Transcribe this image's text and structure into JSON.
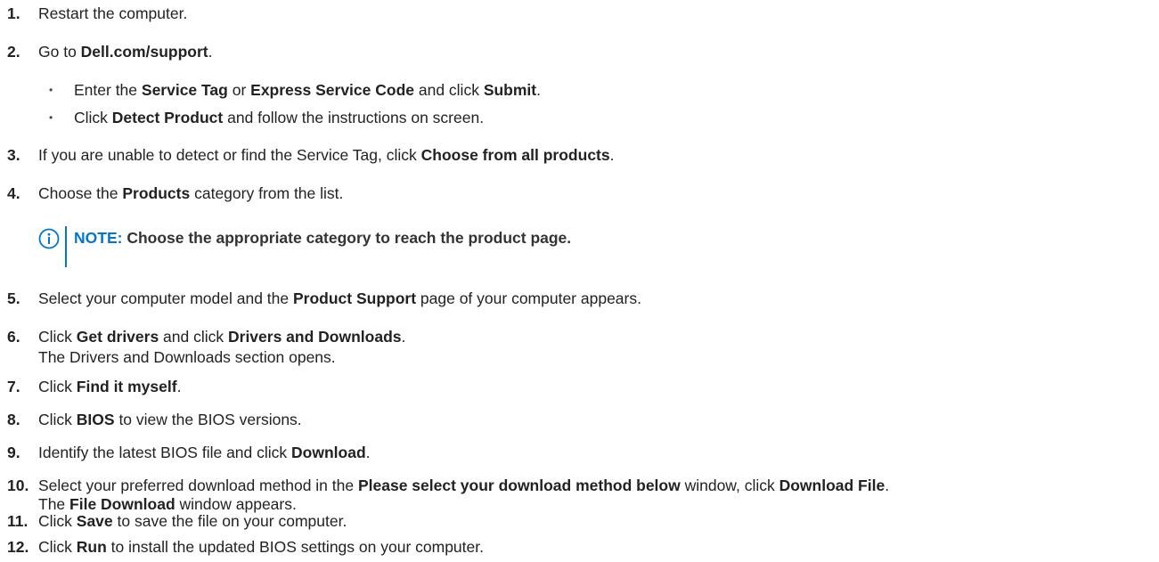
{
  "steps": [
    {
      "num": "1.",
      "parts": [
        {
          "t": "Restart the computer."
        }
      ]
    },
    {
      "num": "2.",
      "parts": [
        {
          "t": "Go to "
        },
        {
          "t": "Dell.com/support",
          "b": true
        },
        {
          "t": "."
        }
      ]
    },
    {
      "num": "3.",
      "parts": [
        {
          "t": "If you are unable to detect or find the Service Tag, click "
        },
        {
          "t": "Choose from all products",
          "b": true
        },
        {
          "t": "."
        }
      ]
    },
    {
      "num": "4.",
      "parts": [
        {
          "t": "Choose the "
        },
        {
          "t": "Products",
          "b": true
        },
        {
          "t": " category from the list."
        }
      ]
    },
    {
      "num": "5.",
      "parts": [
        {
          "t": "Select your computer model and the "
        },
        {
          "t": "Product Support",
          "b": true
        },
        {
          "t": " page of your computer appears."
        }
      ]
    },
    {
      "num": "6.",
      "parts": [
        {
          "t": "Click "
        },
        {
          "t": "Get drivers",
          "b": true
        },
        {
          "t": " and click "
        },
        {
          "t": "Drivers and Downloads",
          "b": true
        },
        {
          "t": "."
        }
      ],
      "line2": [
        {
          "t": "The Drivers and Downloads section opens."
        }
      ]
    },
    {
      "num": "7.",
      "parts": [
        {
          "t": "Click "
        },
        {
          "t": "Find it myself",
          "b": true
        },
        {
          "t": "."
        }
      ]
    },
    {
      "num": "8.",
      "parts": [
        {
          "t": "Click "
        },
        {
          "t": "BIOS",
          "b": true
        },
        {
          "t": " to view the BIOS versions."
        }
      ]
    },
    {
      "num": "9.",
      "parts": [
        {
          "t": "Identify the latest BIOS file and click "
        },
        {
          "t": "Download",
          "b": true
        },
        {
          "t": "."
        }
      ]
    },
    {
      "num": "10.",
      "parts": [
        {
          "t": "Select your preferred download method in the "
        },
        {
          "t": "Please select your download method below",
          "b": true
        },
        {
          "t": " window, click "
        },
        {
          "t": "Download File",
          "b": true
        },
        {
          "t": "."
        }
      ],
      "line2": [
        {
          "t": "The "
        },
        {
          "t": "File Download",
          "b": true
        },
        {
          "t": " window appears."
        }
      ]
    },
    {
      "num": "11.",
      "parts": [
        {
          "t": "Click "
        },
        {
          "t": "Save",
          "b": true
        },
        {
          "t": " to save the file on your computer."
        }
      ]
    },
    {
      "num": "12.",
      "parts": [
        {
          "t": "Click "
        },
        {
          "t": "Run",
          "b": true
        },
        {
          "t": " to install the updated BIOS settings on your computer."
        }
      ]
    }
  ],
  "substeps": [
    {
      "bullet": "•",
      "parts": [
        {
          "t": "Enter the "
        },
        {
          "t": "Service Tag",
          "b": true
        },
        {
          "t": " or "
        },
        {
          "t": "Express Service Code",
          "b": true
        },
        {
          "t": " and click "
        },
        {
          "t": "Submit",
          "b": true
        },
        {
          "t": "."
        }
      ]
    },
    {
      "bullet": "•",
      "parts": [
        {
          "t": "Click "
        },
        {
          "t": "Detect Product",
          "b": true
        },
        {
          "t": " and follow the instructions on screen."
        }
      ]
    }
  ],
  "note": {
    "icon": "info-icon",
    "label": "NOTE:",
    "text": " Choose the appropriate category to reach the product page.",
    "accent": "#0076ce"
  }
}
